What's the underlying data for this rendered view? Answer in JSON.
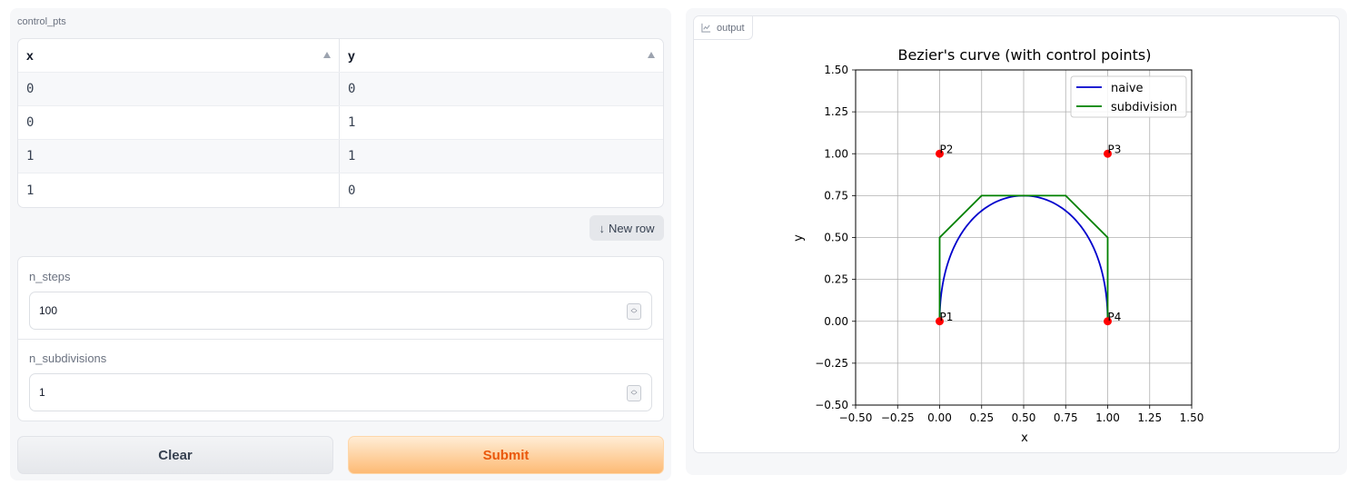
{
  "control_pts": {
    "label": "control_pts",
    "columns": [
      "x",
      "y"
    ],
    "rows": [
      [
        "0",
        "0"
      ],
      [
        "0",
        "1"
      ],
      [
        "1",
        "1"
      ],
      [
        "1",
        "0"
      ]
    ],
    "new_row_label": "New row"
  },
  "params": {
    "n_steps": {
      "label": "n_steps",
      "value": "100"
    },
    "n_subdivisions": {
      "label": "n_subdivisions",
      "value": "1"
    }
  },
  "buttons": {
    "clear": "Clear",
    "submit": "Submit"
  },
  "output": {
    "label": "output"
  },
  "colors": {
    "naive": "#0000cc",
    "subdivision": "#008000",
    "points": "#ff0000",
    "submit_text": "#ea580c"
  },
  "chart_data": {
    "type": "line",
    "title": "Bezier's curve (with control points)",
    "xlabel": "x",
    "ylabel": "y",
    "xlim": [
      -0.5,
      1.5
    ],
    "ylim": [
      -0.5,
      1.5
    ],
    "xticks": [
      -0.5,
      -0.25,
      0.0,
      0.25,
      0.5,
      0.75,
      1.0,
      1.25,
      1.5
    ],
    "yticks": [
      -0.5,
      -0.25,
      0.0,
      0.25,
      0.5,
      0.75,
      1.0,
      1.25,
      1.5
    ],
    "tick_labels": [
      "−0.50",
      "−0.25",
      "0.00",
      "0.25",
      "0.50",
      "0.75",
      "1.00",
      "1.25",
      "1.50"
    ],
    "grid": true,
    "legend": "upper right",
    "series": [
      {
        "name": "naive",
        "kind": "bezier",
        "control_points": [
          [
            0,
            0
          ],
          [
            0,
            1
          ],
          [
            1,
            1
          ],
          [
            1,
            0
          ]
        ]
      },
      {
        "name": "subdivision",
        "x": [
          0,
          0,
          0.25,
          0.5,
          0.75,
          1,
          1
        ],
        "y": [
          0,
          0.5,
          0.75,
          0.75,
          0.75,
          0.5,
          0
        ]
      }
    ],
    "points": [
      {
        "label": "P1",
        "x": 0,
        "y": 0
      },
      {
        "label": "P2",
        "x": 0,
        "y": 1
      },
      {
        "label": "P3",
        "x": 1,
        "y": 1
      },
      {
        "label": "P4",
        "x": 1,
        "y": 0
      }
    ]
  }
}
